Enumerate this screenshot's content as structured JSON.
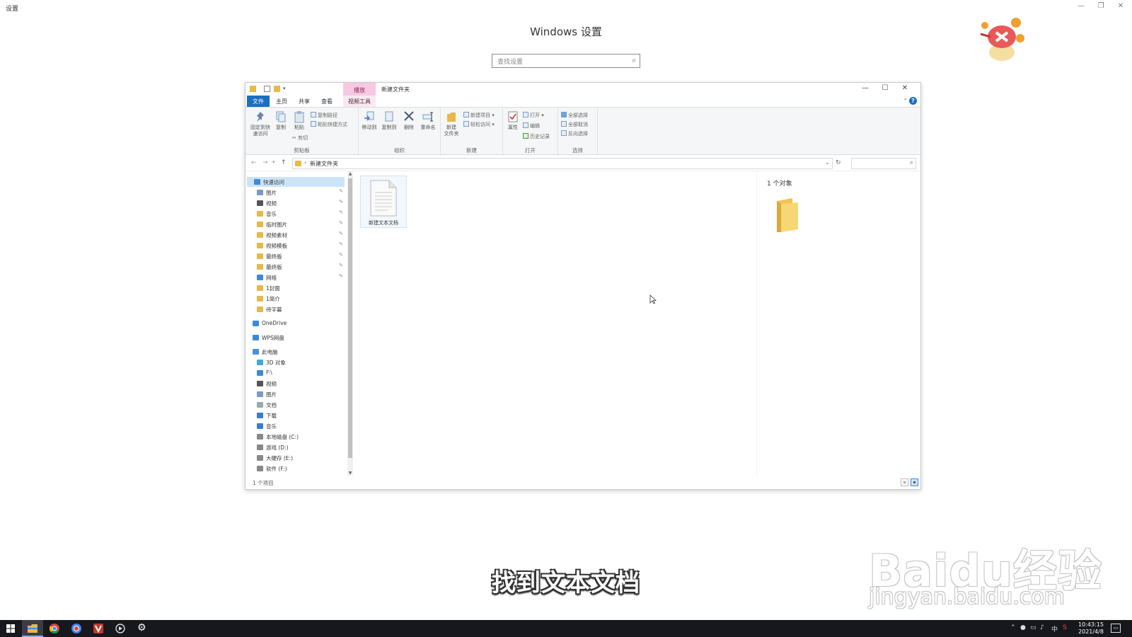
{
  "settings": {
    "window_title": "设置",
    "heading": "Windows 设置",
    "search_placeholder": "查找设置"
  },
  "explorer": {
    "title": "新建文件夹",
    "context_tab_top": "播放",
    "tabs": {
      "file": "文件",
      "home": "主页",
      "share": "共享",
      "view": "查看",
      "video_tools": "视频工具"
    },
    "ribbon": {
      "clipboard": {
        "label": "剪贴板",
        "pin": "固定到快\n速访问",
        "copy": "复制",
        "paste": "粘贴",
        "copy_path": "复制路径",
        "paste_shortcut": "粘贴快捷方式",
        "cut": "剪切"
      },
      "organize": {
        "label": "组织",
        "move_to": "移动到",
        "copy_to": "复制到",
        "delete": "删除",
        "rename": "重命名"
      },
      "new": {
        "label": "新建",
        "new_folder": "新建\n文件夹",
        "new_item": "新建项目 ▾",
        "easy_access": "轻松访问 ▾"
      },
      "open": {
        "label": "打开",
        "properties": "属性",
        "open": "打开 ▾",
        "edit": "编辑",
        "history": "历史记录"
      },
      "select": {
        "label": "选择",
        "select_all": "全部选择",
        "select_none": "全部取消",
        "invert": "反向选择"
      }
    },
    "address": {
      "path": "新建文件夹"
    },
    "nav": {
      "quick_access": "快速访问",
      "quick_items": [
        {
          "label": "图片",
          "pinned": true
        },
        {
          "label": "视频",
          "pinned": true
        },
        {
          "label": "音乐",
          "pinned": true
        },
        {
          "label": "临时图片",
          "pinned": true
        },
        {
          "label": "视频素材",
          "pinned": true
        },
        {
          "label": "视频模板",
          "pinned": true
        },
        {
          "label": "最终版",
          "pinned": true
        },
        {
          "label": "最终版",
          "pinned": true
        },
        {
          "label": "网络",
          "pinned": true
        },
        {
          "label": "1封面",
          "pinned": false
        },
        {
          "label": "1简介",
          "pinned": false
        },
        {
          "label": "待字幕",
          "pinned": false
        }
      ],
      "onedrive": "OneDrive",
      "wps": "WPS网盘",
      "this_pc": "此电脑",
      "pc_items": [
        "3D 对象",
        "F:\\",
        "视频",
        "图片",
        "文档",
        "下载",
        "音乐",
        "本地磁盘 (C:)",
        "游戏 (D:)",
        "大硬存 (E:)",
        "软件 (F:)"
      ]
    },
    "files": [
      {
        "name": "新建文本文档"
      }
    ],
    "preview_count": "1 个对象",
    "status": "1 个项目"
  },
  "subtitle": "找到文本文档",
  "watermark": {
    "main": "Baidu经验",
    "sub": "jingyan.baidu.com"
  },
  "taskbar": {
    "time": "10:43:15",
    "date": "2021/4/8",
    "ime": "中"
  },
  "colors": {
    "accent": "#1a6fc1",
    "folder": "#e8b84a",
    "context_tab": "#f6c9e0",
    "selection": "#cce4f7",
    "taskbar": "#16181d"
  }
}
